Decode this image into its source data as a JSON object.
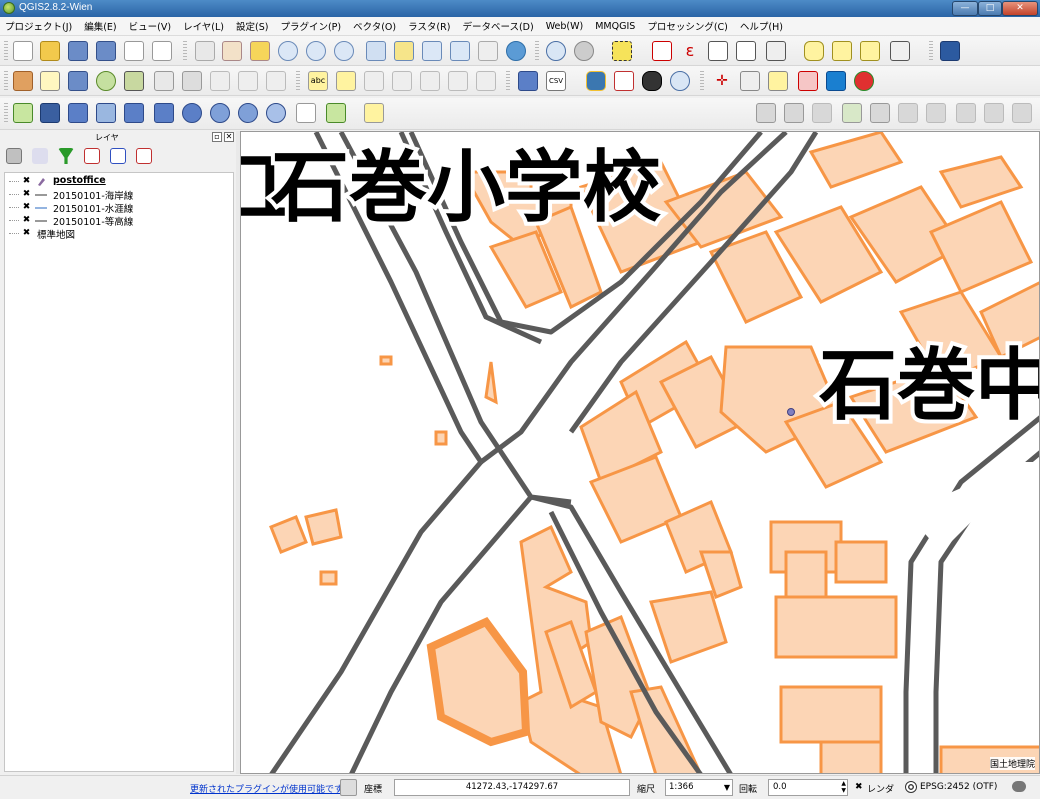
{
  "window": {
    "title": "QGIS2.8.2-Wien",
    "minimize": "—",
    "maximize": "□",
    "close": "✕"
  },
  "menu": [
    "プロジェクト(J)",
    "編集(E)",
    "ビュー(V)",
    "レイヤ(L)",
    "設定(S)",
    "プラグイン(P)",
    "ベクタ(O)",
    "ラスタ(R)",
    "データベース(D)",
    "Web(W)",
    "MMQGIS",
    "プロセッシング(C)",
    "ヘルプ(H)"
  ],
  "toolbar_labels": {
    "csv": "CSV",
    "abc": "abc",
    "epsilon": "ε"
  },
  "layers_panel": {
    "title": "レイヤ",
    "layers": [
      {
        "name": "postoffice",
        "checked": "✖",
        "symbol": "point"
      },
      {
        "name": "20150101-海岸線",
        "checked": "✖",
        "symbol": "line"
      },
      {
        "name": "20150101-水涯線",
        "checked": "✖",
        "symbol": "line-blue"
      },
      {
        "name": "20150101-等高線",
        "checked": "✖",
        "symbol": "line"
      },
      {
        "name": "標準地図",
        "checked": "✖",
        "symbol": "raster"
      }
    ]
  },
  "map": {
    "labels": {
      "school": "石巻小学校",
      "school_prefix": "工",
      "partial": "石巻中"
    },
    "attribution": "国土地理院",
    "colors": {
      "building_fill": "#fcd5b5",
      "building_stroke": "#f79646",
      "road": "#5a5a5a",
      "point": "#8080c0"
    }
  },
  "status": {
    "message": "更新されたプラグインが使用可能です",
    "coord_label": "座標",
    "coord_value": "41272.43,-174297.67",
    "scale_label": "縮尺",
    "scale_value": "1:366",
    "rotation_label": "回転",
    "rotation_value": "0.0",
    "render_checked": "✖",
    "render_label": "レンダ",
    "crs": "EPSG:2452 (OTF)"
  }
}
